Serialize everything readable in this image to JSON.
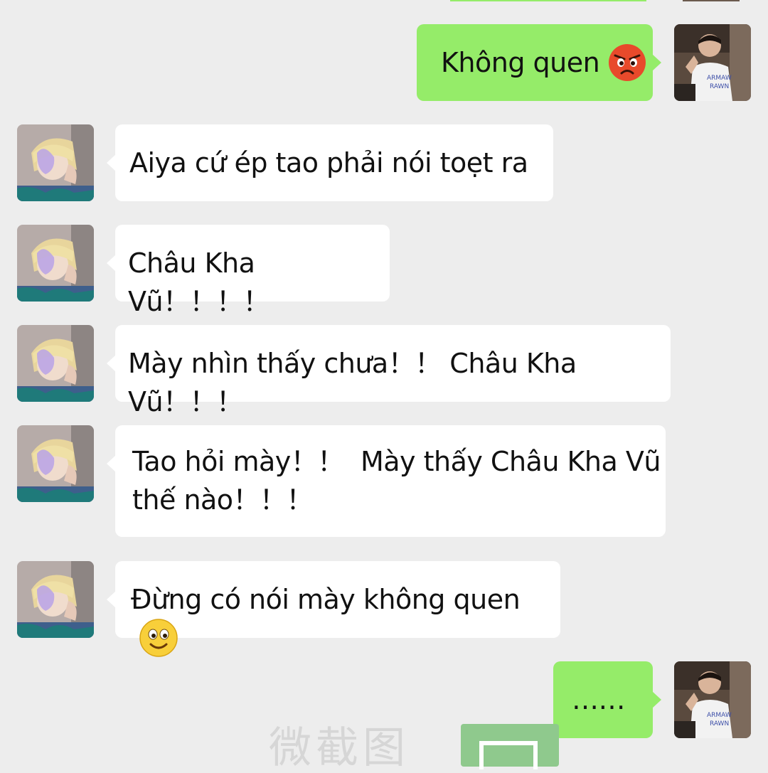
{
  "messages": [
    {
      "side": "out",
      "text": "Không quen",
      "emoji": "angry-face-emoji"
    },
    {
      "side": "in",
      "text": "Aiya cứ ép tao phải nói toẹt ra"
    },
    {
      "side": "in",
      "text": "Châu Kha Vũ！！！！"
    },
    {
      "side": "in",
      "text": "Mày nhìn thấy chưa！！ Châu Kha Vũ！！！"
    },
    {
      "side": "in",
      "line1": "Tao hỏi mày！！  Mày thấy Châu Kha Vũ",
      "line2": "thế nào！！！"
    },
    {
      "side": "in",
      "text": "Đừng có nói mày không quen",
      "emoji": "smiling-face-emoji"
    },
    {
      "side": "out",
      "text": "……"
    }
  ],
  "watermark": {
    "text": "微截图"
  },
  "colors": {
    "background": "#ededed",
    "incoming_bubble": "#ffffff",
    "outgoing_bubble": "#95ec69"
  }
}
